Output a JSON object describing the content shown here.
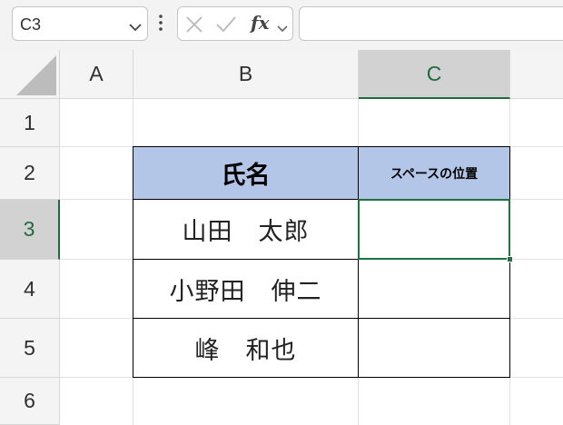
{
  "toolbar": {
    "namebox_value": "C3",
    "fx_label": "fx",
    "formula_value": ""
  },
  "columns": [
    {
      "label": "A",
      "selected": false
    },
    {
      "label": "B",
      "selected": false
    },
    {
      "label": "C",
      "selected": true
    }
  ],
  "rows": [
    {
      "label": "1",
      "selected": false
    },
    {
      "label": "2",
      "selected": false
    },
    {
      "label": "3",
      "selected": true
    },
    {
      "label": "4",
      "selected": false
    },
    {
      "label": "5",
      "selected": false
    },
    {
      "label": "6",
      "selected": false
    }
  ],
  "table": {
    "header_name": "氏名",
    "header_space": "スペースの位置",
    "header_fill": "#b4c6e7",
    "names": [
      "山田　太郎",
      "小野田　伸二",
      "峰　和也"
    ],
    "space_values": [
      "",
      "",
      ""
    ]
  },
  "active_cell": "C3",
  "accent_color": "#1e7145"
}
